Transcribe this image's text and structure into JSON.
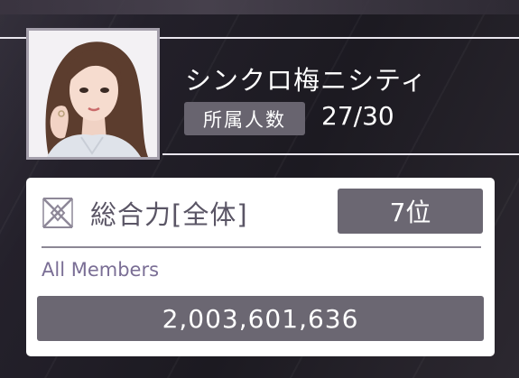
{
  "unit": {
    "name": "シンクロ梅ニシティ",
    "members_label": "所属人数",
    "members_count": "27/30",
    "avatar_icon": "member-portrait"
  },
  "power": {
    "icon": "power-emblem-icon",
    "label": "総合力[全体]",
    "rank": "7位",
    "scope_label": "All Members",
    "value": "2,003,601,636"
  },
  "colors": {
    "background": "#26232c",
    "panel": "#ffffff",
    "chip": "#6b6772",
    "accent_text": "#7a6e95",
    "label_text": "#5a5565"
  }
}
